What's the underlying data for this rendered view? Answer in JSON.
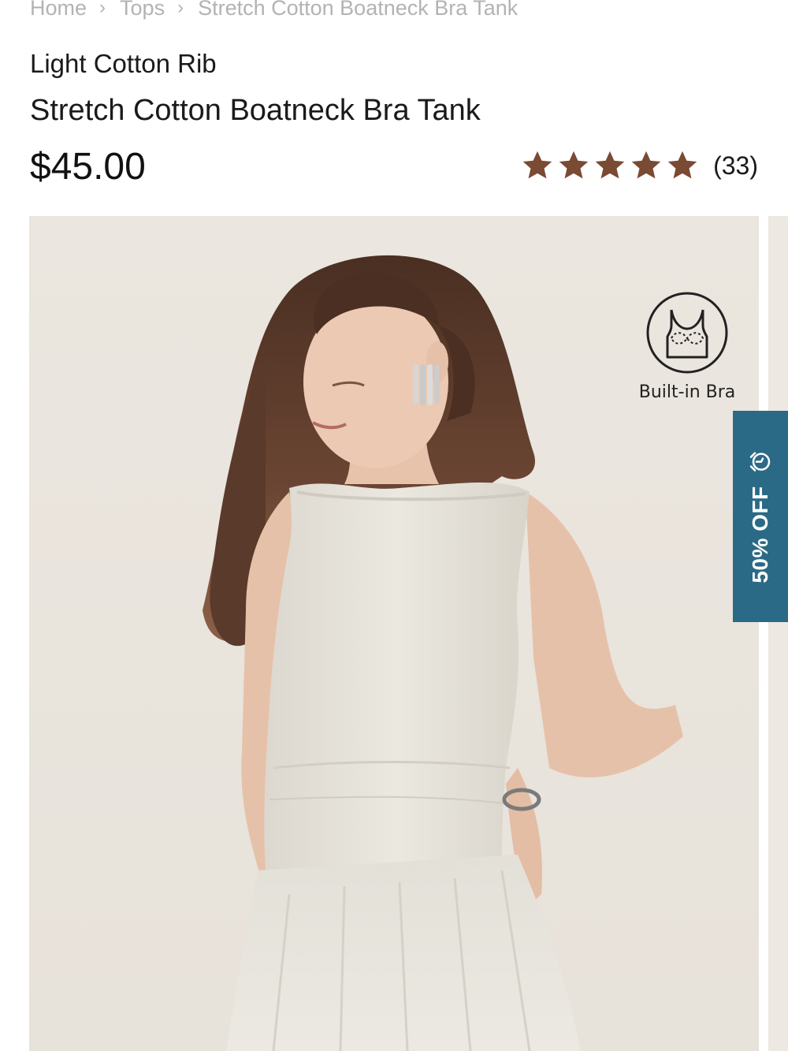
{
  "breadcrumb": {
    "items": [
      "Home",
      "Tops",
      "Stretch Cotton Boatneck Bra Tank"
    ],
    "separator": ">"
  },
  "product": {
    "collection": "Light Cotton Rib",
    "title": "Stretch Cotton Boatneck Bra Tank",
    "price": "$45.00",
    "rating": {
      "stars": 5,
      "star_color": "#7a4a33",
      "review_count": "(33)"
    }
  },
  "gallery": {
    "feature_badge": {
      "icon": "built-in-bra-icon",
      "label": "Built-in Bra"
    }
  },
  "promo": {
    "text": "50% OFF",
    "icon": "alarm-clock-icon",
    "color": "#2b6a86"
  }
}
